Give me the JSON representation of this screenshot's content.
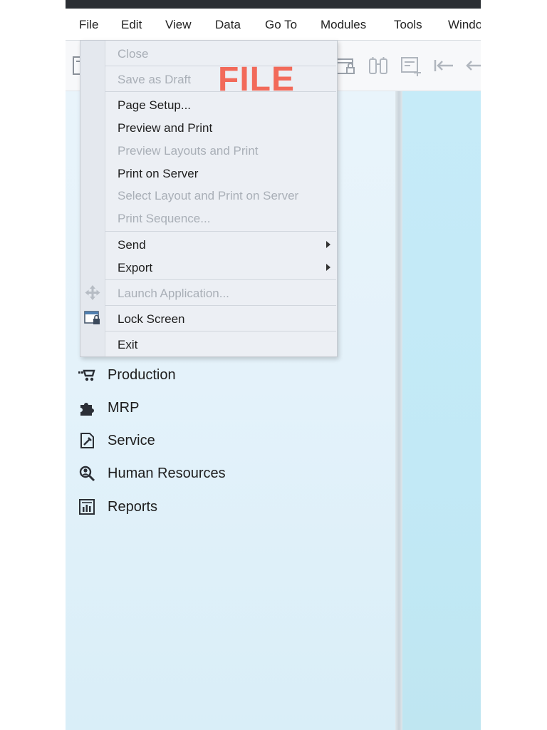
{
  "menubar": {
    "items": [
      "File",
      "Edit",
      "View",
      "Data",
      "Go To",
      "Modules",
      "Tools",
      "Windo"
    ]
  },
  "toolbar": {
    "icons": [
      "report-icon",
      "lock-screen-icon",
      "binoculars-icon",
      "form-add-icon",
      "first-record-icon",
      "previous-record-icon"
    ]
  },
  "file_menu": {
    "items": {
      "close": "Close",
      "save_as_draft": "Save as Draft",
      "page_setup": "Page Setup...",
      "preview_and_print": "Preview and Print",
      "preview_layouts_and_print": "Preview Layouts and Print",
      "print_on_server": "Print on Server",
      "select_layout_and_print_on_server": "Select Layout and Print on Server",
      "print_sequence": "Print Sequence...",
      "send": "Send",
      "export": "Export",
      "launch_application": "Launch Application...",
      "lock_screen": "Lock Screen",
      "exit": "Exit"
    }
  },
  "annotation": {
    "label": "FILE",
    "color": "#f26a5a"
  },
  "modules": {
    "items": [
      {
        "label": "Production",
        "icon": "production-icon"
      },
      {
        "label": "MRP",
        "icon": "puzzle-icon"
      },
      {
        "label": "Service",
        "icon": "service-icon"
      },
      {
        "label": "Human Resources",
        "icon": "human-resources-icon"
      },
      {
        "label": "Reports",
        "icon": "reports-icon"
      }
    ]
  },
  "colors": {
    "topbar": "#2a2e33",
    "panel_left": "#e4f2fa",
    "panel_right": "#c4eaf7",
    "disabled_text": "#a9afb7"
  }
}
